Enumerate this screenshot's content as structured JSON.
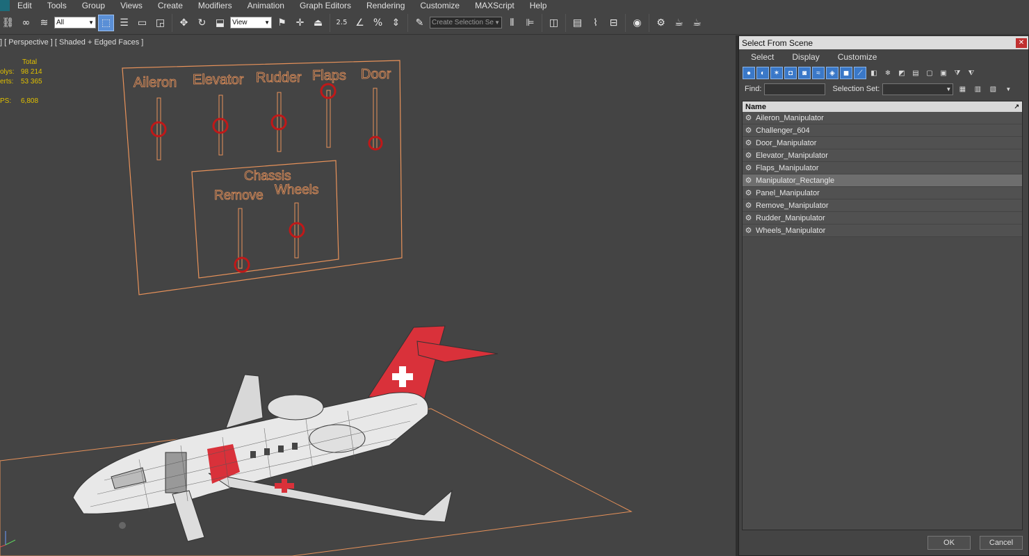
{
  "menubar": {
    "items": [
      "Edit",
      "Tools",
      "Group",
      "Views",
      "Create",
      "Modifiers",
      "Animation",
      "Graph Editors",
      "Rendering",
      "Customize",
      "MAXScript",
      "Help"
    ]
  },
  "toolbar": {
    "filter_value": "All",
    "coord_value": "View",
    "selection_set_placeholder": "Create Selection Se",
    "snap_label": "2.5"
  },
  "viewport": {
    "label": "] [ Perspective ] [ Shaded + Edged Faces ]",
    "stats": {
      "header": "Total",
      "polys_label": "olys:",
      "polys_value": "98 214",
      "verts_label": "erts:",
      "verts_value": "53 365",
      "fps_label": "PS:",
      "fps_value": "6,808"
    },
    "panel_labels": {
      "aileron": "Aileron",
      "elevator": "Elevator",
      "rudder": "Rudder",
      "flaps": "Flaps",
      "door": "Door",
      "chassis": "Chassis",
      "remove": "Remove",
      "wheels": "Wheels"
    },
    "colors": {
      "panel_outline": "#e8925a",
      "handle": "#c01818",
      "fuselage": "#e8e8e8",
      "livery_red": "#d9313a"
    }
  },
  "dialog": {
    "title": "Select From Scene",
    "menu": [
      "Select",
      "Display",
      "Customize"
    ],
    "find_label": "Find:",
    "selection_set_label": "Selection Set:",
    "column_name": "Name",
    "items": [
      {
        "label": "Aileron_Manipulator",
        "selected": false
      },
      {
        "label": "Challenger_604",
        "selected": false
      },
      {
        "label": "Door_Manipulator",
        "selected": false
      },
      {
        "label": "Elevator_Manipulator",
        "selected": false
      },
      {
        "label": "Flaps_Manipulator",
        "selected": false
      },
      {
        "label": "Manipulator_Rectangle",
        "selected": true
      },
      {
        "label": "Panel_Manipulator",
        "selected": false
      },
      {
        "label": "Remove_Manipulator",
        "selected": false
      },
      {
        "label": "Rudder_Manipulator",
        "selected": false
      },
      {
        "label": "Wheels_Manipulator",
        "selected": false
      }
    ],
    "ok_label": "OK",
    "cancel_label": "Cancel"
  }
}
